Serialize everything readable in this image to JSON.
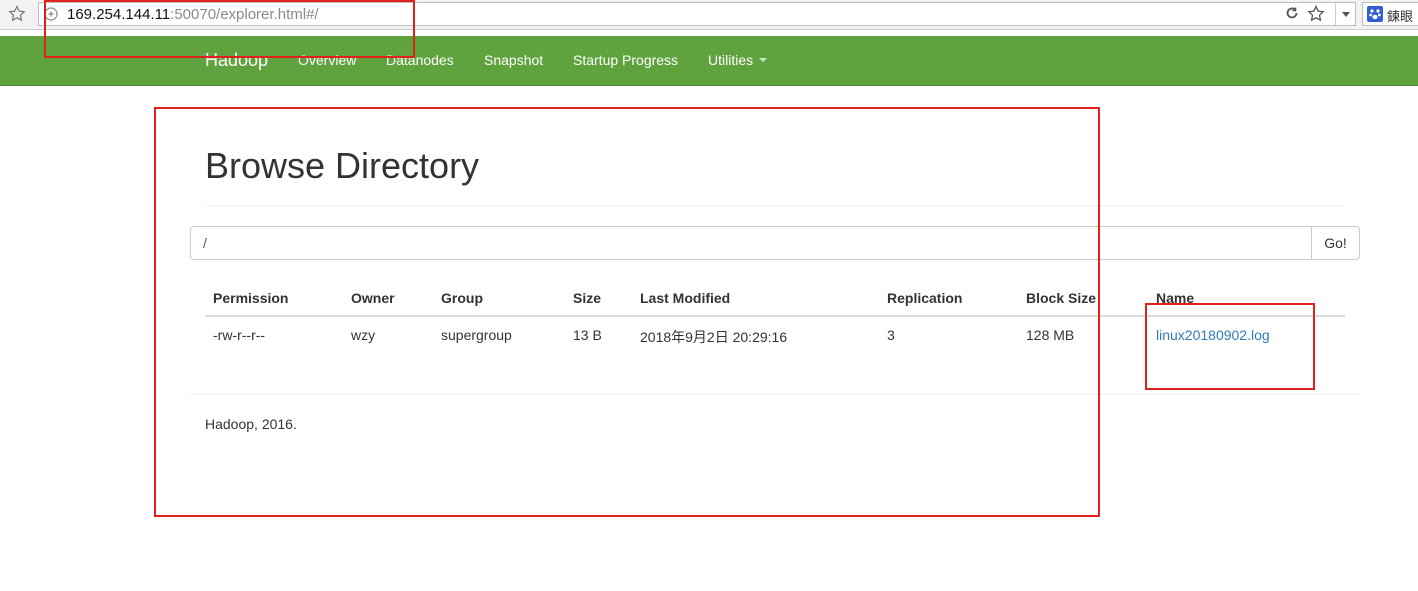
{
  "browser": {
    "url_host": "169.254.144.11",
    "url_path": ":50070/explorer.html#/",
    "search_text": "鍊眼"
  },
  "navbar": {
    "brand": "Hadoop",
    "items": [
      {
        "label": "Overview"
      },
      {
        "label": "Datanodes"
      },
      {
        "label": "Snapshot"
      },
      {
        "label": "Startup Progress"
      },
      {
        "label": "Utilities"
      }
    ]
  },
  "page": {
    "title": "Browse Directory",
    "path_value": "/",
    "go_label": "Go!"
  },
  "table": {
    "headers": [
      "Permission",
      "Owner",
      "Group",
      "Size",
      "Last Modified",
      "Replication",
      "Block Size",
      "Name"
    ],
    "rows": [
      [
        "-rw-r--r--",
        "wzy",
        "supergroup",
        "13 B",
        "2018年9月2日 20:29:16",
        "3",
        "128 MB",
        "linux20180902.log"
      ]
    ]
  },
  "footer": {
    "text": "Hadoop, 2016."
  },
  "colors": {
    "navbar": "#5fa33e",
    "link": "#337ab7",
    "annotation": "#e0201a"
  }
}
